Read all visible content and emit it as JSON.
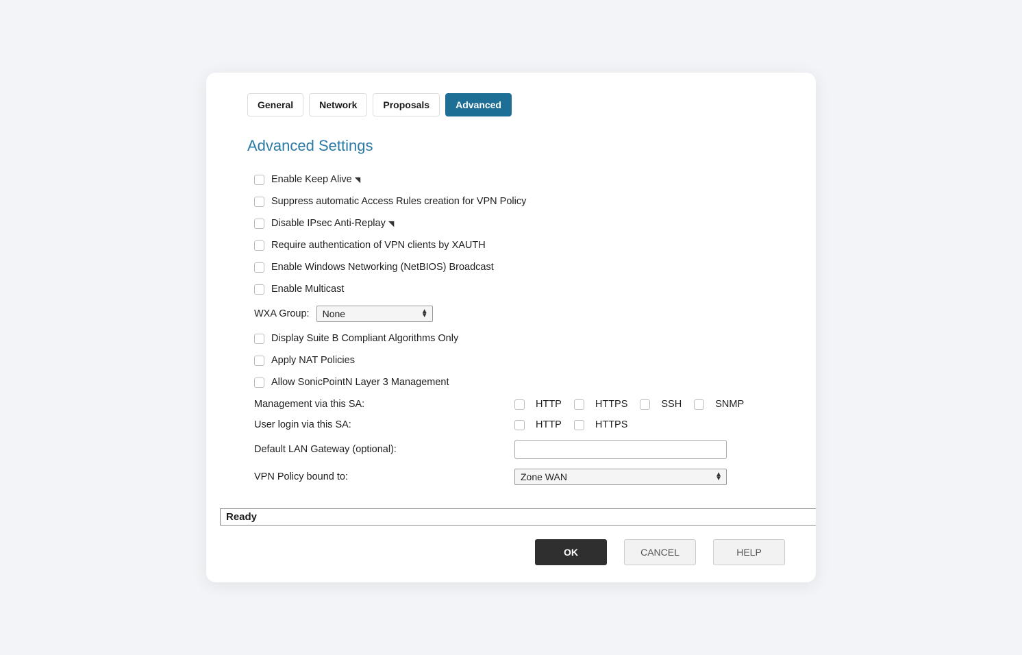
{
  "tabs": {
    "general": "General",
    "network": "Network",
    "proposals": "Proposals",
    "advanced": "Advanced"
  },
  "section_title": "Advanced Settings",
  "checkboxes": {
    "keep_alive": "Enable Keep Alive",
    "suppress_rules": "Suppress automatic Access Rules creation for VPN Policy",
    "disable_antireplay": "Disable IPsec Anti-Replay",
    "require_xauth": "Require authentication of VPN clients by XAUTH",
    "netbios": "Enable Windows Networking (NetBIOS) Broadcast",
    "multicast": "Enable Multicast",
    "suite_b": "Display Suite B Compliant Algorithms Only",
    "nat_policies": "Apply NAT Policies",
    "sonicpoint": "Allow SonicPointN Layer 3 Management"
  },
  "wxa": {
    "label": "WXA Group:",
    "value": "None"
  },
  "management": {
    "label": "Management via this SA:",
    "http": "HTTP",
    "https": "HTTPS",
    "ssh": "SSH",
    "snmp": "SNMP"
  },
  "userlogin": {
    "label": "User login via this SA:",
    "http": "HTTP",
    "https": "HTTPS"
  },
  "gateway": {
    "label": "Default LAN Gateway (optional):",
    "value": ""
  },
  "bound": {
    "label": "VPN Policy bound to:",
    "value": "Zone WAN"
  },
  "status": "Ready",
  "buttons": {
    "ok": "OK",
    "cancel": "CANCEL",
    "help": "HELP"
  }
}
